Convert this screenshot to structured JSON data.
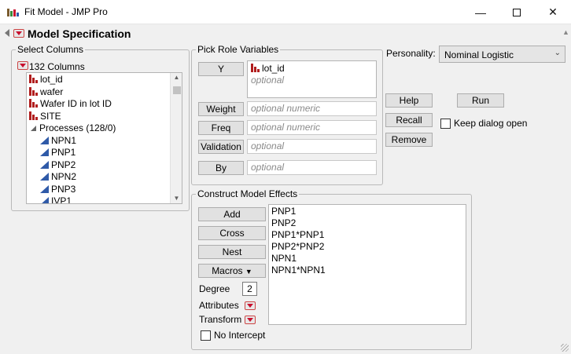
{
  "window": {
    "title": "Fit Model - JMP Pro",
    "minimize_icon": "minimize-icon",
    "maximize_icon": "maximize-icon",
    "close_icon": "close-icon"
  },
  "header": {
    "title": "Model Specification"
  },
  "select_columns": {
    "label": "Select Columns",
    "count_label": "132 Columns",
    "items": [
      {
        "label": "lot_id",
        "icon": "nominal-icon"
      },
      {
        "label": "wafer",
        "icon": "nominal-icon"
      },
      {
        "label": "Wafer ID in lot ID",
        "icon": "nominal-icon"
      },
      {
        "label": "SITE",
        "icon": "nominal-icon"
      },
      {
        "label": "Processes (128/0)",
        "icon": "group-expand-icon"
      },
      {
        "label": "NPN1",
        "icon": "continuous-icon"
      },
      {
        "label": "PNP1",
        "icon": "continuous-icon"
      },
      {
        "label": "PNP2",
        "icon": "continuous-icon"
      },
      {
        "label": "NPN2",
        "icon": "continuous-icon"
      },
      {
        "label": "PNP3",
        "icon": "continuous-icon"
      },
      {
        "label": "IVP1",
        "icon": "continuous-icon"
      }
    ]
  },
  "pick_role": {
    "label": "Pick Role Variables",
    "y": {
      "button": "Y",
      "value": "lot_id",
      "placeholder": "optional"
    },
    "weight": {
      "button": "Weight",
      "placeholder": "optional numeric"
    },
    "freq": {
      "button": "Freq",
      "placeholder": "optional numeric"
    },
    "validation": {
      "button": "Validation",
      "placeholder": "optional"
    },
    "by": {
      "button": "By",
      "placeholder": "optional"
    }
  },
  "personality": {
    "label": "Personality:",
    "value": "Nominal Logistic"
  },
  "actions": {
    "help": "Help",
    "run": "Run",
    "recall": "Recall",
    "remove": "Remove",
    "keep_open": "Keep dialog open"
  },
  "construct": {
    "label": "Construct Model Effects",
    "add": "Add",
    "cross": "Cross",
    "nest": "Nest",
    "macros": "Macros",
    "degree_label": "Degree",
    "degree_value": "2",
    "attributes_label": "Attributes",
    "transform_label": "Transform",
    "no_intercept": "No Intercept",
    "effects": [
      "PNP1",
      "PNP2",
      "PNP1*PNP1",
      "PNP2*PNP2",
      "NPN1",
      "NPN1*NPN1"
    ]
  }
}
